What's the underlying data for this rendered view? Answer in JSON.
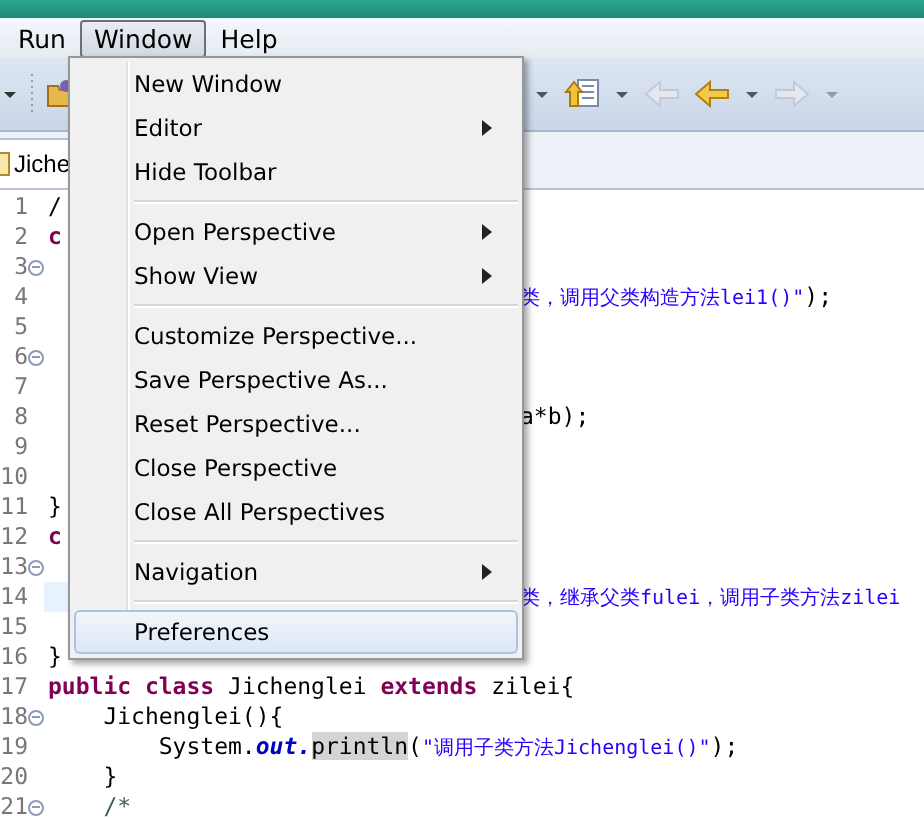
{
  "menu_bar": [
    {
      "label": "Run",
      "selected": false
    },
    {
      "label": "Window",
      "selected": true
    },
    {
      "label": "Help",
      "selected": false
    }
  ],
  "editor_tabs": [
    {
      "label": "Jiche",
      "selected": true
    }
  ],
  "editor_lines": [
    {
      "number": "1",
      "fold": false,
      "current": false,
      "segments": [
        {
          "kind": "plain",
          "text": "/"
        }
      ]
    },
    {
      "number": "2",
      "fold": false,
      "current": false,
      "segments": [
        {
          "kind": "keyword",
          "text": "c"
        }
      ]
    },
    {
      "number": "3",
      "fold": true,
      "current": false
    },
    {
      "number": "4",
      "fold": false,
      "current": false,
      "tail": [
        {
          "kind": "string",
          "text": "类，调用父类构造方法lei1()\""
        },
        {
          "kind": "plain",
          "text": ");"
        }
      ]
    },
    {
      "number": "5",
      "fold": false,
      "current": false
    },
    {
      "number": "6",
      "fold": true,
      "current": false
    },
    {
      "number": "7",
      "fold": false,
      "current": false
    },
    {
      "number": "8",
      "fold": false,
      "current": false,
      "tail": [
        {
          "kind": "plain",
          "text": "a*b);"
        }
      ]
    },
    {
      "number": "9",
      "fold": false,
      "current": false
    },
    {
      "number": "10",
      "fold": false,
      "current": false
    },
    {
      "number": "11",
      "fold": false,
      "current": false,
      "segments": [
        {
          "kind": "plain",
          "text": "}"
        }
      ]
    },
    {
      "number": "12",
      "fold": false,
      "current": false,
      "segments": [
        {
          "kind": "keyword",
          "text": "c"
        }
      ]
    },
    {
      "number": "13",
      "fold": true,
      "current": false
    },
    {
      "number": "14",
      "fold": false,
      "current": true,
      "tail": [
        {
          "kind": "string",
          "text": "类，继承父类fulei，调用子类方法zilei"
        }
      ]
    },
    {
      "number": "15",
      "fold": false,
      "current": false
    },
    {
      "number": "16",
      "fold": false,
      "current": false,
      "segments": [
        {
          "kind": "plain",
          "text": "}"
        }
      ]
    },
    {
      "number": "17",
      "fold": false,
      "current": false,
      "segments": [
        {
          "kind": "keyword",
          "text": "public class"
        },
        {
          "kind": "plain",
          "text": " Jichenglei "
        },
        {
          "kind": "keyword",
          "text": "extends"
        },
        {
          "kind": "plain",
          "text": " zilei{"
        }
      ]
    },
    {
      "number": "18",
      "fold": true,
      "current": false,
      "segments": [
        {
          "kind": "plain",
          "text": "    Jichenglei(){"
        }
      ]
    },
    {
      "number": "19",
      "fold": false,
      "current": false,
      "segments": [
        {
          "kind": "plain",
          "text": "        System."
        },
        {
          "kind": "field",
          "text": "out."
        },
        {
          "kind": "occurrence",
          "text": "println"
        },
        {
          "kind": "plain",
          "text": "("
        },
        {
          "kind": "string",
          "text": "\"调用子类方法Jichenglei()\""
        },
        {
          "kind": "plain",
          "text": ");"
        }
      ]
    },
    {
      "number": "20",
      "fold": false,
      "current": false,
      "segments": [
        {
          "kind": "plain",
          "text": "    }"
        }
      ]
    },
    {
      "number": "21",
      "fold": true,
      "current": false,
      "segments": [
        {
          "kind": "comment",
          "text": "    /*"
        }
      ]
    }
  ],
  "window_menu": [
    {
      "kind": "item",
      "label": "New Window",
      "submenu": false,
      "selected": false
    },
    {
      "kind": "item",
      "label": "Editor",
      "submenu": true,
      "selected": false
    },
    {
      "kind": "item",
      "label": "Hide Toolbar",
      "submenu": false,
      "selected": false
    },
    {
      "kind": "separator"
    },
    {
      "kind": "item",
      "label": "Open Perspective",
      "submenu": true,
      "selected": false
    },
    {
      "kind": "item",
      "label": "Show View",
      "submenu": true,
      "selected": false
    },
    {
      "kind": "separator"
    },
    {
      "kind": "item",
      "label": "Customize Perspective...",
      "submenu": false,
      "selected": false
    },
    {
      "kind": "item",
      "label": "Save Perspective As...",
      "submenu": false,
      "selected": false
    },
    {
      "kind": "item",
      "label": "Reset Perspective...",
      "submenu": false,
      "selected": false
    },
    {
      "kind": "item",
      "label": "Close Perspective",
      "submenu": false,
      "selected": false
    },
    {
      "kind": "item",
      "label": "Close All Perspectives",
      "submenu": false,
      "selected": false
    },
    {
      "kind": "separator"
    },
    {
      "kind": "item",
      "label": "Navigation",
      "submenu": true,
      "selected": false
    },
    {
      "kind": "separator"
    },
    {
      "kind": "item",
      "label": "Preferences",
      "submenu": false,
      "selected": true
    }
  ]
}
